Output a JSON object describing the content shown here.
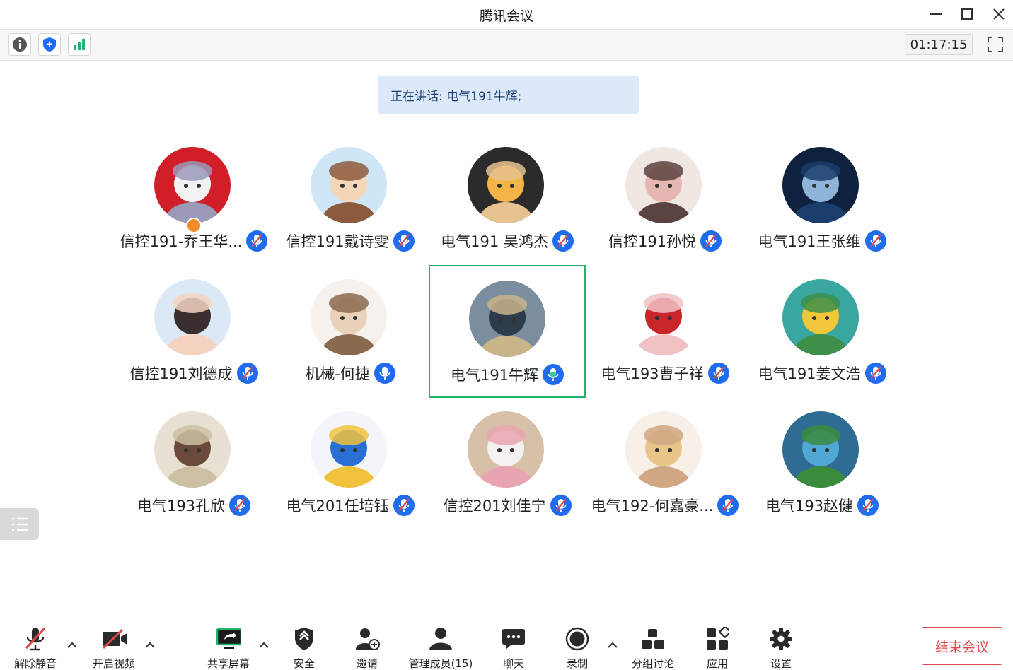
{
  "window": {
    "title": "腾讯会议"
  },
  "toolbar": {
    "timer": "01:17:15"
  },
  "speaking": {
    "text": "正在讲话: 电气191牛辉;"
  },
  "participants": [
    {
      "name": "信控191-乔王华...",
      "mic": "muted",
      "host": true
    },
    {
      "name": "信控191戴诗雯",
      "mic": "muted"
    },
    {
      "name": "电气191 吴鸿杰",
      "mic": "muted"
    },
    {
      "name": "信控191孙悦",
      "mic": "muted"
    },
    {
      "name": "电气191王张维",
      "mic": "muted"
    },
    {
      "name": "信控191刘德成",
      "mic": "muted"
    },
    {
      "name": "机械-何捷",
      "mic": "on"
    },
    {
      "name": "电气191牛辉",
      "mic": "speaking",
      "active": true
    },
    {
      "name": "电气193曹子祥",
      "mic": "muted"
    },
    {
      "name": "电气191姜文浩",
      "mic": "muted"
    },
    {
      "name": "电气193孔欣",
      "mic": "muted"
    },
    {
      "name": "电气201任培钰",
      "mic": "muted"
    },
    {
      "name": "信控201刘佳宁",
      "mic": "muted"
    },
    {
      "name": "电气192-何嘉豪...",
      "mic": "muted"
    },
    {
      "name": "电气193赵健",
      "mic": "muted"
    }
  ],
  "bottom": {
    "unmute": "解除静音",
    "video": "开启视频",
    "share": "共享屏幕",
    "security": "安全",
    "invite": "邀请",
    "members": "管理成员(15)",
    "chat": "聊天",
    "record": "录制",
    "breakout": "分组讨论",
    "apps": "应用",
    "settings": "设置",
    "end": "结束会议"
  },
  "colors": {
    "accent": "#1f6cf0",
    "speaking": "#1fb56a",
    "end": "#e04848"
  }
}
